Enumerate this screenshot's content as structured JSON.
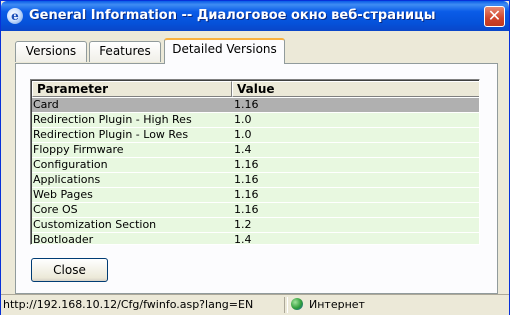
{
  "window": {
    "title": "General Information -- Диалоговое окно веб-страницы",
    "close_glyph": "✕",
    "title_icon": "ie-icon",
    "accent": "#0a5ce8"
  },
  "tabs": [
    {
      "label": "Versions"
    },
    {
      "label": "Features"
    },
    {
      "label": "Detailed Versions",
      "active": true
    }
  ],
  "table": {
    "headers": {
      "parameter": "Parameter",
      "value": "Value"
    },
    "rows": [
      {
        "parameter": "Card",
        "value": "1.16"
      },
      {
        "parameter": "Redirection Plugin - High Res",
        "value": "1.0"
      },
      {
        "parameter": "Redirection Plugin - Low Res",
        "value": "1.0"
      },
      {
        "parameter": "Floppy Firmware",
        "value": "1.4"
      },
      {
        "parameter": "Configuration",
        "value": "1.16"
      },
      {
        "parameter": "Applications",
        "value": "1.16"
      },
      {
        "parameter": "Web Pages",
        "value": "1.16"
      },
      {
        "parameter": "Core OS",
        "value": "1.16"
      },
      {
        "parameter": "Customization Section",
        "value": "1.2"
      },
      {
        "parameter": "Bootloader",
        "value": "1.4"
      }
    ],
    "selected_row_index": 0,
    "row_color": "#e8f8e0",
    "selected_color": "#b0b0b0"
  },
  "buttons": {
    "close_label": "Close"
  },
  "status": {
    "url": "http://192.168.10.12/Cfg/fwinfo.asp?lang=EN",
    "zone": "Интернет",
    "zone_icon": "globe-icon"
  }
}
